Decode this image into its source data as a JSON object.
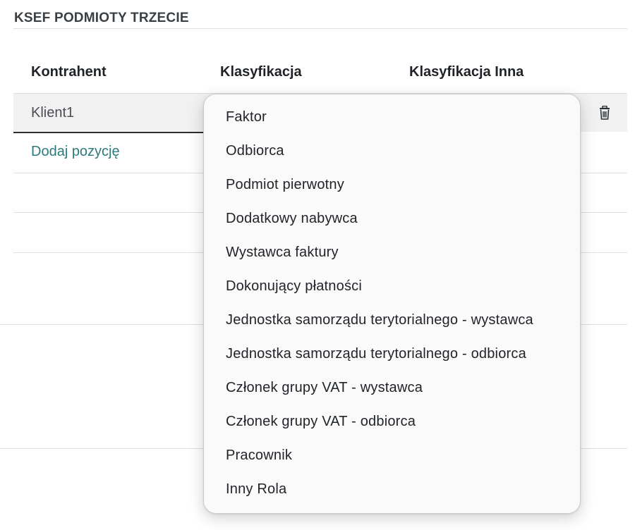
{
  "section": {
    "title": "KSEF PODMIOTY TRZECIE"
  },
  "table": {
    "columns": [
      "Kontrahent",
      "Klasyfikacja",
      "Klasyfikacja Inna"
    ],
    "rows": [
      {
        "kontrahent": "Klient1"
      }
    ],
    "add_row_label": "Dodaj pozycję"
  },
  "dropdown": {
    "options": [
      "Faktor",
      "Odbiorca",
      "Podmiot pierwotny",
      "Dodatkowy nabywca",
      "Wystawca faktury",
      "Dokonujący płatności",
      "Jednostka samorządu terytorialnego - wystawca",
      "Jednostka samorządu terytorialnego - odbiorca",
      "Członek grupy VAT - wystawca",
      "Członek grupy VAT - odbiorca",
      "Pracownik",
      "Inny Rola"
    ]
  },
  "icons": {
    "delete": "trash-icon"
  },
  "colors": {
    "link": "#2c7a7b",
    "selected_row_bg": "#f1f1f2",
    "divider": "#dcdfe3"
  }
}
